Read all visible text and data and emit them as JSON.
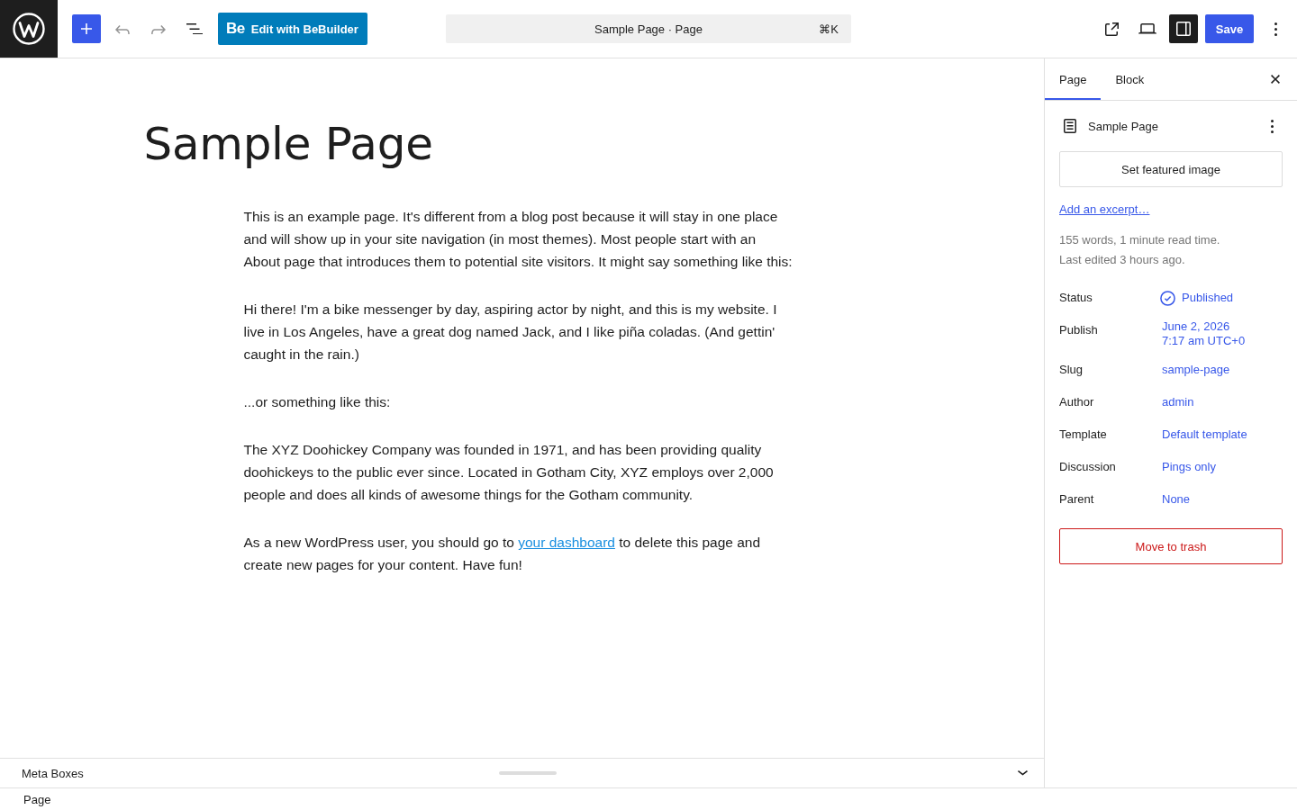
{
  "top_bar": {
    "left_tools": [
      {
        "kind": "add",
        "disabled": false
      },
      {
        "kind": "undo",
        "disabled": true
      },
      {
        "kind": "redo",
        "disabled": true
      },
      {
        "kind": "list-view",
        "disabled": false
      }
    ],
    "builder_button": {
      "badge": "Be",
      "label": "Edit with BeBuilder"
    },
    "command_bar": {
      "title": "Sample Page · Page",
      "shortcut": "⌘K"
    },
    "right_tools": [
      {
        "kind": "view",
        "pressed": false
      },
      {
        "kind": "preview",
        "pressed": false
      },
      {
        "kind": "settings",
        "pressed": true
      }
    ],
    "save_button": "Save"
  },
  "editor": {
    "title": "Sample Page",
    "paragraphs": [
      {
        "runs": [
          {
            "kind": "text",
            "text": "This is an example page. It's different from a blog post because it will stay in one place and will show up in your site navigation (in most themes). Most people start with an About page that introduces them to potential site visitors. It might say something like this:"
          }
        ]
      },
      {
        "runs": [
          {
            "kind": "text",
            "text": "Hi there! I'm a bike messenger by day, aspiring actor by night, and this is my website. I live in Los Angeles, have a great dog named Jack, and I like piña coladas. (And gettin' caught in the rain.)"
          }
        ]
      },
      {
        "runs": [
          {
            "kind": "text",
            "text": "...or something like this:"
          }
        ]
      },
      {
        "runs": [
          {
            "kind": "text",
            "text": "The XYZ Doohickey Company was founded in 1971, and has been providing quality doohickeys to the public ever since. Located in Gotham City, XYZ employs over 2,000 people and does all kinds of awesome things for the Gotham community."
          }
        ]
      },
      {
        "runs": [
          {
            "kind": "text",
            "text": "As a new WordPress user, you should go to "
          },
          {
            "kind": "link",
            "text": "your dashboard"
          },
          {
            "kind": "text",
            "text": " to delete this page and create new pages for your content. Have fun!"
          }
        ]
      }
    ]
  },
  "meta_boxes": {
    "label": "Meta Boxes",
    "expanded": false
  },
  "sidebar": {
    "tabs": [
      {
        "label": "Page",
        "selected": true
      },
      {
        "label": "Block",
        "selected": false
      }
    ],
    "summary_title": "Sample Page",
    "featured_image_button": "Set featured image",
    "excerpt_link": "Add an excerpt…",
    "stats": [
      "155 words, 1 minute read time.",
      "Last edited 3 hours ago."
    ],
    "fields": [
      {
        "label": "Status",
        "kind": "status",
        "value": "Published"
      },
      {
        "label": "Publish",
        "kind": "date",
        "value": "June 2, 2026",
        "time": "7:17 am UTC+0"
      },
      {
        "label": "Slug",
        "kind": "link",
        "value": "sample-page"
      },
      {
        "label": "Author",
        "kind": "link",
        "value": "admin"
      },
      {
        "label": "Template",
        "kind": "link",
        "value": "Default template"
      },
      {
        "label": "Discussion",
        "kind": "link",
        "value": "Pings only"
      },
      {
        "label": "Parent",
        "kind": "link",
        "value": "None"
      }
    ],
    "trash_button": "Move to trash"
  },
  "status_bar": {
    "breadcrumb": "Page"
  }
}
